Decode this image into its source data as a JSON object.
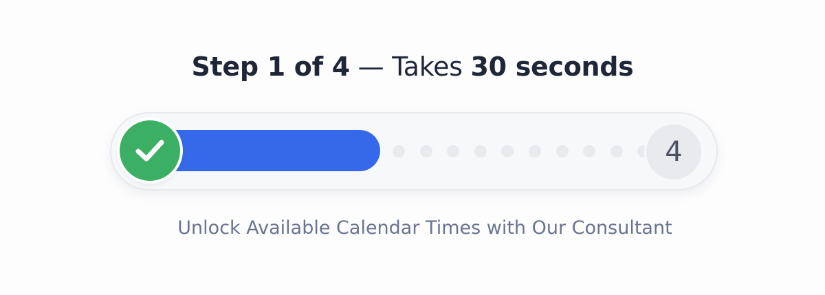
{
  "heading": {
    "step_prefix": "Step 1 of 4",
    "separator": " — Takes ",
    "duration": "30 seconds"
  },
  "progress": {
    "current_step": 1,
    "total_steps": 4,
    "completed_fraction": 0.4,
    "completed_icon": "check-icon",
    "final_step_label": "4",
    "fill_color": "#3668ea",
    "complete_color": "#3bb064",
    "remaining_dot_count": 10
  },
  "subtitle": "Unlock Available Calendar Times with Our Consultant"
}
